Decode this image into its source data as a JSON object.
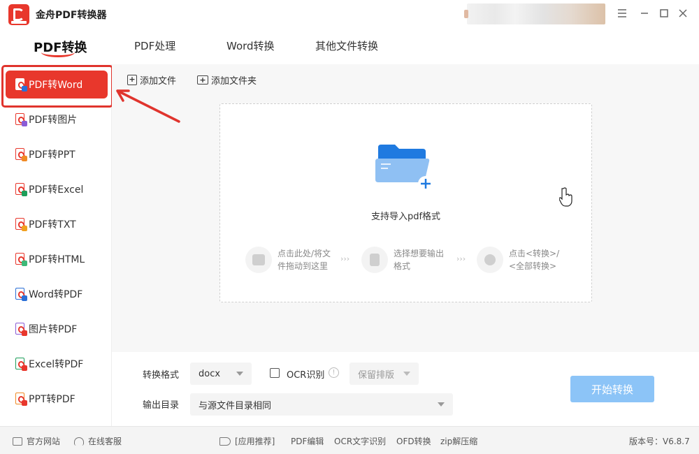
{
  "app": {
    "title": "金舟PDF转换器",
    "logo_icon": "pdf-logo-icon",
    "accent_color": "#e8372c"
  },
  "window_controls": {
    "menu_icon": "menu-icon",
    "minimize_icon": "minimize-icon",
    "maximize_icon": "maximize-icon",
    "close_icon": "close-icon"
  },
  "top_tabs": [
    {
      "label": "PDF转换",
      "active": true
    },
    {
      "label": "PDF处理",
      "active": false
    },
    {
      "label": "Word转换",
      "active": false
    },
    {
      "label": "其他文件转换",
      "active": false
    }
  ],
  "sidebar": {
    "items": [
      {
        "label": "PDF转Word",
        "active": true,
        "badge_color": "#2b6fd6"
      },
      {
        "label": "PDF转图片",
        "active": false,
        "badge_color": "#8a5cd6"
      },
      {
        "label": "PDF转PPT",
        "active": false,
        "badge_color": "#f08a24"
      },
      {
        "label": "PDF转Excel",
        "active": false,
        "badge_color": "#1e9e5a"
      },
      {
        "label": "PDF转TXT",
        "active": false,
        "badge_color": "#f0a020"
      },
      {
        "label": "PDF转HTML",
        "active": false,
        "badge_color": "#3cb878"
      },
      {
        "label": "Word转PDF",
        "active": false,
        "badge_color": "#2b6fd6"
      },
      {
        "label": "图片转PDF",
        "active": false,
        "badge_color": "#8a5cd6"
      },
      {
        "label": "Excel转PDF",
        "active": false,
        "badge_color": "#1e9e5a"
      },
      {
        "label": "PPT转PDF",
        "active": false,
        "badge_color": "#f08a24"
      }
    ]
  },
  "toolbar": {
    "add_file": "添加文件",
    "add_folder": "添加文件夹"
  },
  "drop_zone": {
    "text": "支持导入pdf格式",
    "icon": "folder-add-icon",
    "steps": [
      {
        "line1": "点击此处/将文",
        "line2": "件拖动到这里",
        "icon": "folder-icon"
      },
      {
        "line1": "选择想要输出",
        "line2": "格式",
        "icon": "file-export-icon"
      },
      {
        "line1": "点击<转换>/",
        "line2": "<全部转换>",
        "icon": "convert-icon"
      }
    ],
    "step_separator": "›››"
  },
  "settings": {
    "format_label": "转换格式",
    "format_value": "docx",
    "ocr_label": "OCR识别",
    "ocr_checked": false,
    "layout_value": "保留排版",
    "output_label": "输出目录",
    "output_value": "与源文件目录相同",
    "start_button": "开始转换",
    "start_color": "#8cc4f7"
  },
  "statusbar": {
    "website": "官方网站",
    "support": "在线客服",
    "recommend": "[应用推荐]",
    "links": [
      "PDF编辑",
      "OCR文字识别",
      "OFD转换",
      "zip解压缩"
    ],
    "version": "版本号：V6.8.7"
  }
}
